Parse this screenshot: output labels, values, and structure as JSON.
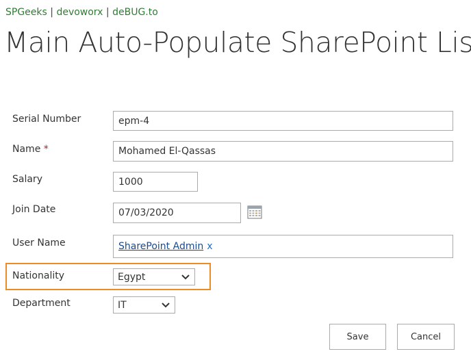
{
  "breadcrumb": {
    "items": [
      "SPGeeks",
      "devoworx",
      "deBUG.to"
    ],
    "separator": "|"
  },
  "page": {
    "title": "Main Auto-Populate SharePoint List"
  },
  "form": {
    "serial_number": {
      "label": "Serial Number",
      "value": "epm-4"
    },
    "name": {
      "label": "Name",
      "required_mark": "*",
      "value": "Mohamed El-Qassas"
    },
    "salary": {
      "label": "Salary",
      "value": "1000"
    },
    "join_date": {
      "label": "Join Date",
      "value": "07/03/2020",
      "icon": "calendar-icon"
    },
    "user_name": {
      "label": "User Name",
      "value": "SharePoint Admin",
      "remove": "x"
    },
    "nationality": {
      "label": "Nationality",
      "value": "Egypt"
    },
    "department": {
      "label": "Department",
      "value": "IT"
    }
  },
  "buttons": {
    "save": "Save",
    "cancel": "Cancel"
  },
  "colors": {
    "breadcrumb": "#2e7d32",
    "highlight": "#f08a24",
    "link": "#1a4a8a"
  }
}
